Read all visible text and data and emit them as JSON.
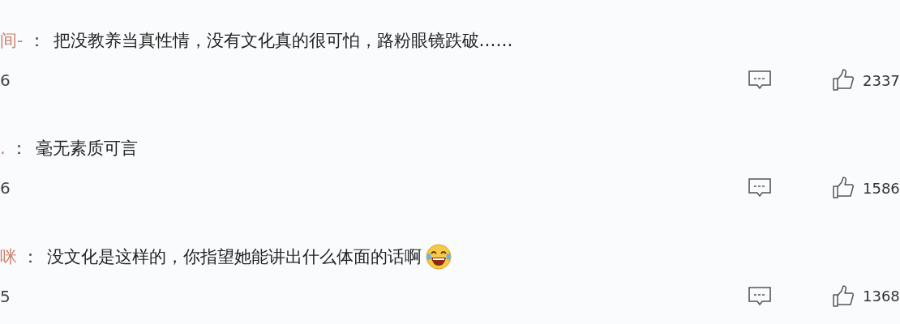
{
  "comments": [
    {
      "author": "间-",
      "separator": "：",
      "text": "把没教养当真性情，没有文化真的很可怕，路粉眼镜跌破……",
      "emoji": false,
      "date": "6",
      "likes": "2337"
    },
    {
      "author": ".",
      "separator": "：",
      "text": "毫无素质可言",
      "emoji": false,
      "date": "6",
      "likes": "1586"
    },
    {
      "author": "咪",
      "separator": "：",
      "text": "没文化是这样的，你指望她能讲出什么体面的话啊",
      "emoji": true,
      "date": "5",
      "likes": "1368"
    }
  ]
}
